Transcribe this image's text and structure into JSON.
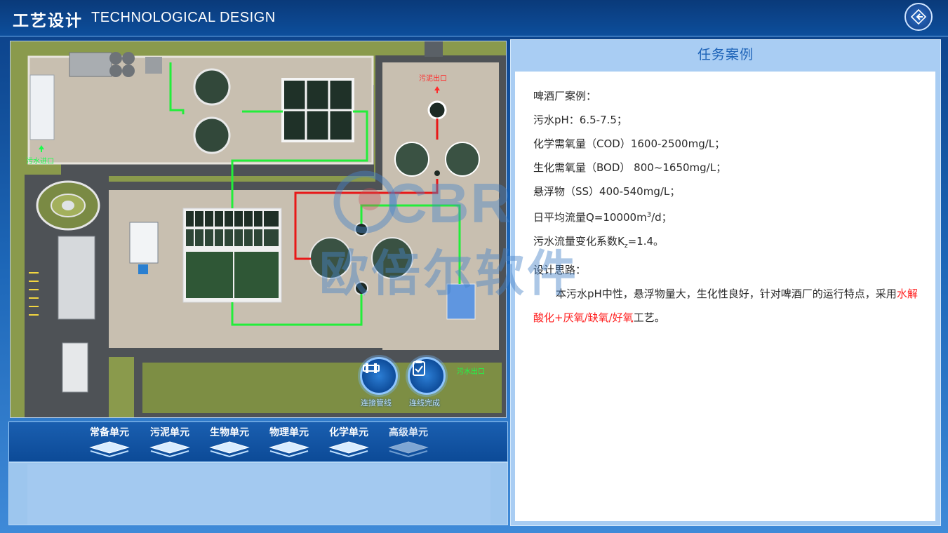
{
  "header": {
    "title_cn": "工艺设计",
    "title_en": "TECHNOLOGICAL DESIGN",
    "back_icon": "back-arrow-icon"
  },
  "map": {
    "labels": {
      "sewage_inlet": "污水进口",
      "sludge_outlet": "污泥出口",
      "sewage_outlet": "污水出口"
    },
    "tools": {
      "connect_pipe": "连接管线",
      "connect_done": "连线完成"
    },
    "pipe_colors": {
      "water": "#22ee3a",
      "sludge": "#e81818"
    }
  },
  "units": [
    {
      "label": "常备单元",
      "enabled": true
    },
    {
      "label": "污泥单元",
      "enabled": true
    },
    {
      "label": "生物单元",
      "enabled": true
    },
    {
      "label": "物理单元",
      "enabled": true
    },
    {
      "label": "化学单元",
      "enabled": true
    },
    {
      "label": "高级单元",
      "enabled": false
    }
  ],
  "task": {
    "title": "任务案例",
    "case_title": "啤酒厂案例：",
    "ph": "污水pH：6.5-7.5；",
    "cod": "化学需氧量（COD）1600-2500mg/L；",
    "bod": "生化需氧量（BOD） 800~1650mg/L；",
    "ss": "悬浮物（SS）400-540mg/L；",
    "flow_prefix": "日平均流量Q=10000m",
    "flow_sup": "3",
    "flow_suffix": "/d；",
    "kz_prefix": "污水流量变化系数K",
    "kz_sub": "z",
    "kz_suffix": "=1.4。",
    "idea_title": "设计思路：",
    "idea_text": "本污水pH中性，悬浮物量大，生化性良好，针对啤酒厂的运行特点，采用",
    "idea_highlight": "水解酸化+厌氧/缺氧/好氧",
    "idea_end": "工艺。"
  },
  "watermark": {
    "logo_text": "CBR",
    "company": "欧倍尔软件"
  },
  "colors": {
    "accent": "#1d63b8",
    "highlight": "#ff2020"
  }
}
